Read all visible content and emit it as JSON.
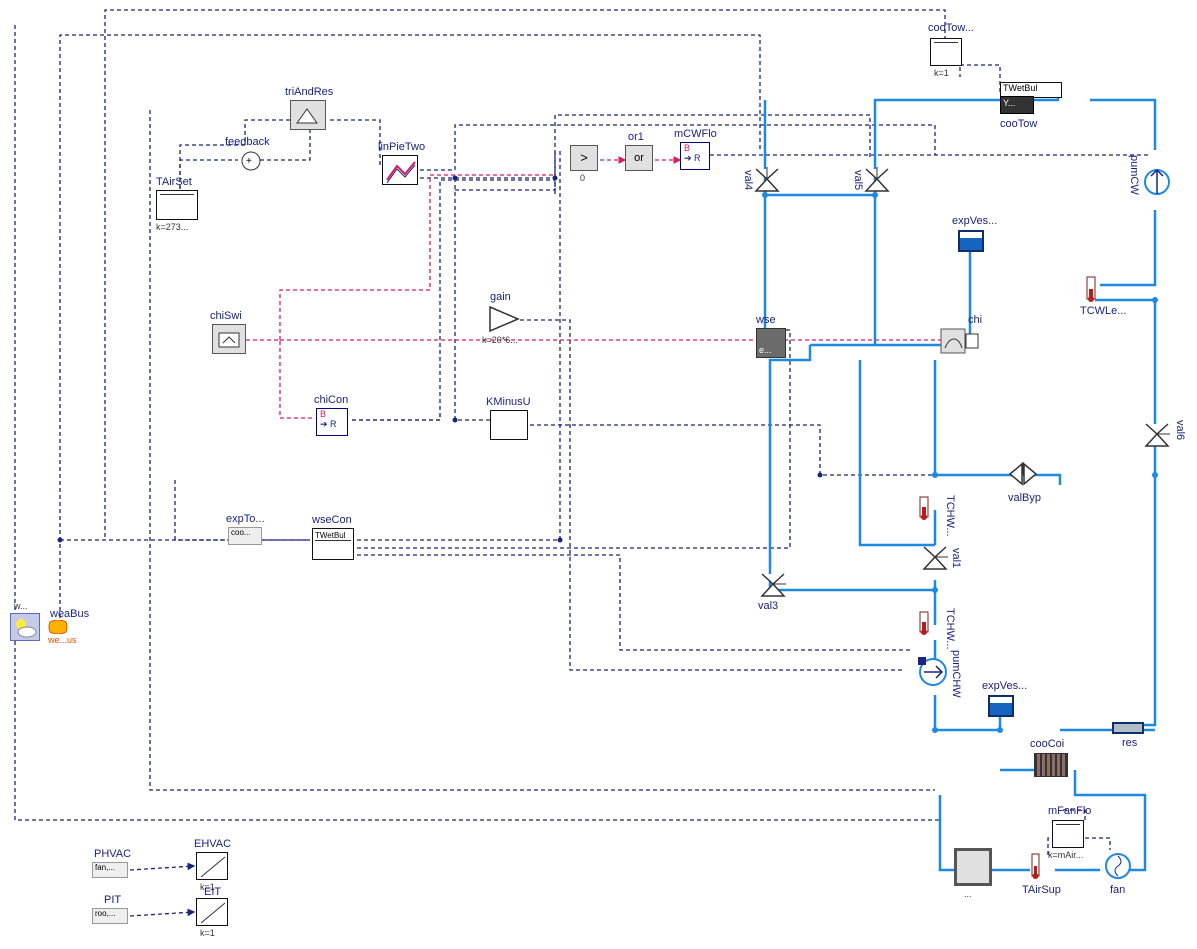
{
  "colors": {
    "signal_dashed": "#1a237e",
    "boolean": "#d81b60",
    "fluid": "#1e88e5",
    "block_border": "#111"
  },
  "blocks": {
    "cooTowSP": {
      "label": "cooTow...",
      "sublabel": "k=1"
    },
    "TWetBul1": {
      "label": "TWetBul"
    },
    "cooTow": {
      "label": "cooTow",
      "inner": "Y..."
    },
    "pumCW": {
      "label": "pumCW"
    },
    "expVesChi": {
      "label": "expVes..."
    },
    "TCWLe": {
      "label": "TCWLe..."
    },
    "val4": {
      "label": "val4"
    },
    "val5": {
      "label": "val5"
    },
    "wse": {
      "label": "wse",
      "inner": "e..."
    },
    "chi": {
      "label": "chi"
    },
    "valByp": {
      "label": "valByp"
    },
    "val6": {
      "label": "val6"
    },
    "TCHW1": {
      "label": "TCHW..."
    },
    "val1": {
      "label": "val1"
    },
    "val3": {
      "label": "val3"
    },
    "TCHW2": {
      "label": "TCHW..."
    },
    "pumCHW": {
      "label": "pumCHW"
    },
    "expVesCHW": {
      "label": "expVes..."
    },
    "cooCoi": {
      "label": "cooCoi"
    },
    "res": {
      "label": "res"
    },
    "mFanFlo": {
      "label": "mFanFlo",
      "sublabel": "k=mAir..."
    },
    "TAirSup": {
      "label": "TAirSup"
    },
    "fan": {
      "label": "fan"
    },
    "room": {
      "label": "..."
    },
    "triAndRes": {
      "label": "triAndRes"
    },
    "feedback": {
      "label": "feedback"
    },
    "linPieTwo": {
      "label": "linPieTwo"
    },
    "TAirSet": {
      "label": "TAirSet",
      "sublabel": "k=273..."
    },
    "gt0": {
      "label": ">",
      "sublabel": "0"
    },
    "or1": {
      "label": "or1",
      "inner": "or"
    },
    "mCWFlo": {
      "label": "mCWFlo",
      "inner_top": "B",
      "inner_bot": "➔ R"
    },
    "chiSwi": {
      "label": "chiSwi"
    },
    "chiCon": {
      "label": "chiCon",
      "inner_top": "B",
      "inner_bot": "➔ R"
    },
    "gain": {
      "label": "gain",
      "sublabel": "k=20*6..."
    },
    "KMinusU": {
      "label": "KMinusU"
    },
    "expTo": {
      "label": "expTo...",
      "sublabel": "coo..."
    },
    "wseCon": {
      "label": "wseCon",
      "inner": "TWetBul"
    },
    "weaDat": {
      "label": "w..."
    },
    "weaBus": {
      "label": "weaBus",
      "sublabel": "we...us"
    },
    "PHVAC": {
      "label": "PHVAC",
      "sublabel": "fan,..."
    },
    "EHVAC": {
      "label": "EHVAC",
      "sublabel": "k=1"
    },
    "PIT": {
      "label": "PIT",
      "sublabel": "roo,..."
    },
    "EIT": {
      "label": "EIT",
      "sublabel": "k=1"
    }
  }
}
